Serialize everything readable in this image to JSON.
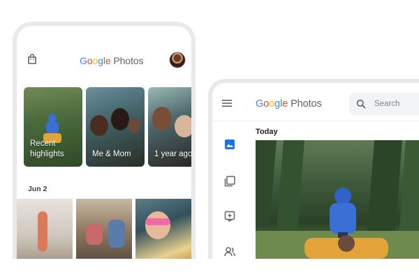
{
  "phone": {
    "app_name": {
      "g": "G",
      "o1": "o",
      "o2": "o",
      "g2": "g",
      "l": "l",
      "e": "e",
      "photos": " Photos"
    },
    "highlights": [
      {
        "label_line1": "Recent",
        "label_line2": "highlights"
      },
      {
        "label_line1": "Me & Mom",
        "label_line2": ""
      },
      {
        "label_line1": "1 year ago",
        "label_line2": ""
      }
    ],
    "section_date": "Jun 2"
  },
  "tablet": {
    "app_name": {
      "g": "G",
      "o1": "o",
      "o2": "o",
      "g2": "g",
      "l": "l",
      "e": "e",
      "photos": " Photos"
    },
    "search_placeholder": "Search",
    "section_label": "Today",
    "sidebar_icons": [
      "photos-icon",
      "albums-icon",
      "add-photo-icon",
      "sharing-icon"
    ]
  },
  "colors": {
    "google_blue": "#4285F4",
    "google_red": "#EA4335",
    "google_yellow": "#FBBC05",
    "google_green": "#34A853",
    "photos_text": "#5f6368",
    "active_blue": "#1a73e8"
  }
}
